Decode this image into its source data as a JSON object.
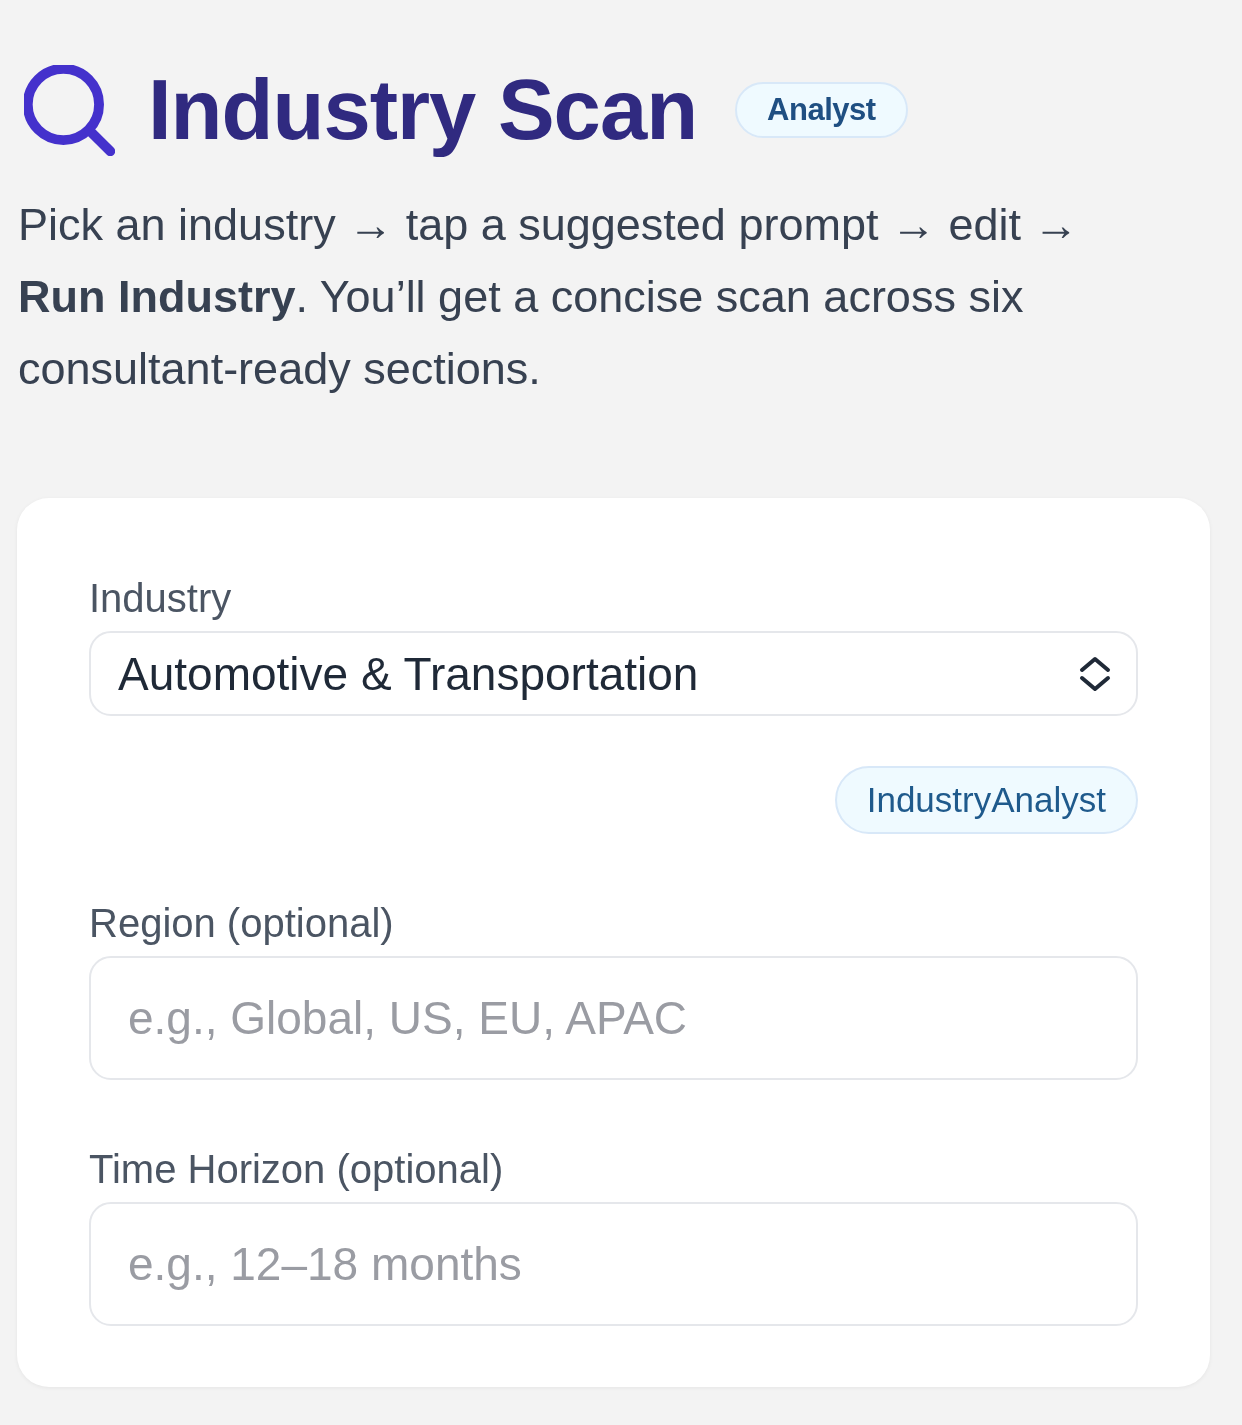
{
  "header": {
    "title": "Industry Scan",
    "badge": "Analyst",
    "description": "Pick an industry → tap a suggested prompt → edit → **Run Industry**. You’ll get a concise scan across six consultant-ready sections."
  },
  "form": {
    "fields": [
      {
        "kind": "select",
        "label": "Industry",
        "value": "Automotive & Transportation",
        "tag": "IndustryAnalyst"
      },
      {
        "kind": "text",
        "label": "Region (optional)",
        "placeholder": "e.g., Global, US, EU, APAC"
      },
      {
        "kind": "text",
        "label": "Time Horizon (optional)",
        "placeholder": "e.g., 12–18 months"
      }
    ]
  }
}
